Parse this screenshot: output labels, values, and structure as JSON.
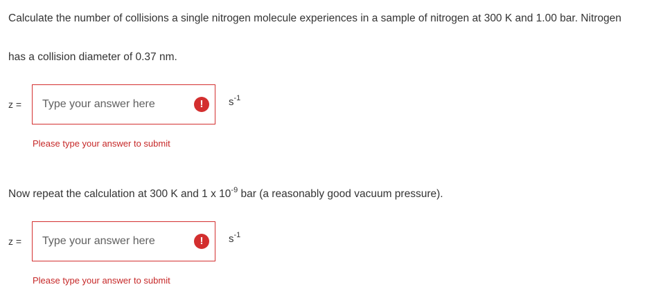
{
  "question": {
    "line1": "Calculate the number of collisions a single nitrogen molecule experiences in a sample of nitrogen at 300 K and 1.00 bar. Nitrogen",
    "line2": "has a collision diameter of 0.37 nm."
  },
  "part1": {
    "variable_label": "z =",
    "input_placeholder": "Type your answer here",
    "input_value": "",
    "unit_base": "s",
    "unit_exponent": "-1",
    "error_message": "Please type your answer to submit",
    "alert_glyph": "!",
    "alert_icon": "exclamation-circle-icon"
  },
  "part2": {
    "prompt_before": "Now repeat the calculation at 300 K and 1 x 10",
    "prompt_exponent": "-9",
    "prompt_after": " bar (a reasonably good vacuum pressure).",
    "variable_label": "z =",
    "input_placeholder": "Type your answer here",
    "input_value": "",
    "unit_base": "s",
    "unit_exponent": "-1",
    "error_message": "Please type your answer to submit",
    "alert_glyph": "!",
    "alert_icon": "exclamation-circle-icon"
  },
  "colors": {
    "error": "#d32f2f",
    "text": "#333333",
    "placeholder": "#5f5f5f"
  }
}
